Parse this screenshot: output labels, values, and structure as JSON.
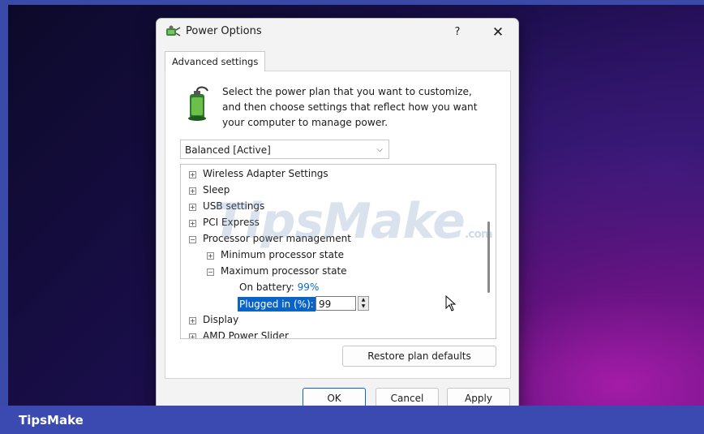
{
  "dialog": {
    "title": "Power Options",
    "help": "?",
    "close": "✕",
    "tab": "Advanced settings",
    "description": "Select the power plan that you want to customize, and then choose settings that reflect how you want your computer to manage power.",
    "plan_select": "Balanced [Active]",
    "tree": {
      "wireless": "Wireless Adapter Settings",
      "sleep": "Sleep",
      "usb": "USB settings",
      "pci": "PCI Express",
      "processor": "Processor power management",
      "min_state": "Minimum processor state",
      "max_state": "Maximum processor state",
      "on_battery_label": "On battery:",
      "on_battery_value": "99%",
      "plugged_label": "Plugged in (%):",
      "plugged_value": "99",
      "display": "Display",
      "amd": "AMD Power Slider"
    },
    "restore": "Restore plan defaults",
    "ok": "OK",
    "cancel": "Cancel",
    "apply": "Apply"
  },
  "watermark": {
    "text": "TipsMake",
    "suffix": ".com"
  },
  "brand": "TipsMake"
}
